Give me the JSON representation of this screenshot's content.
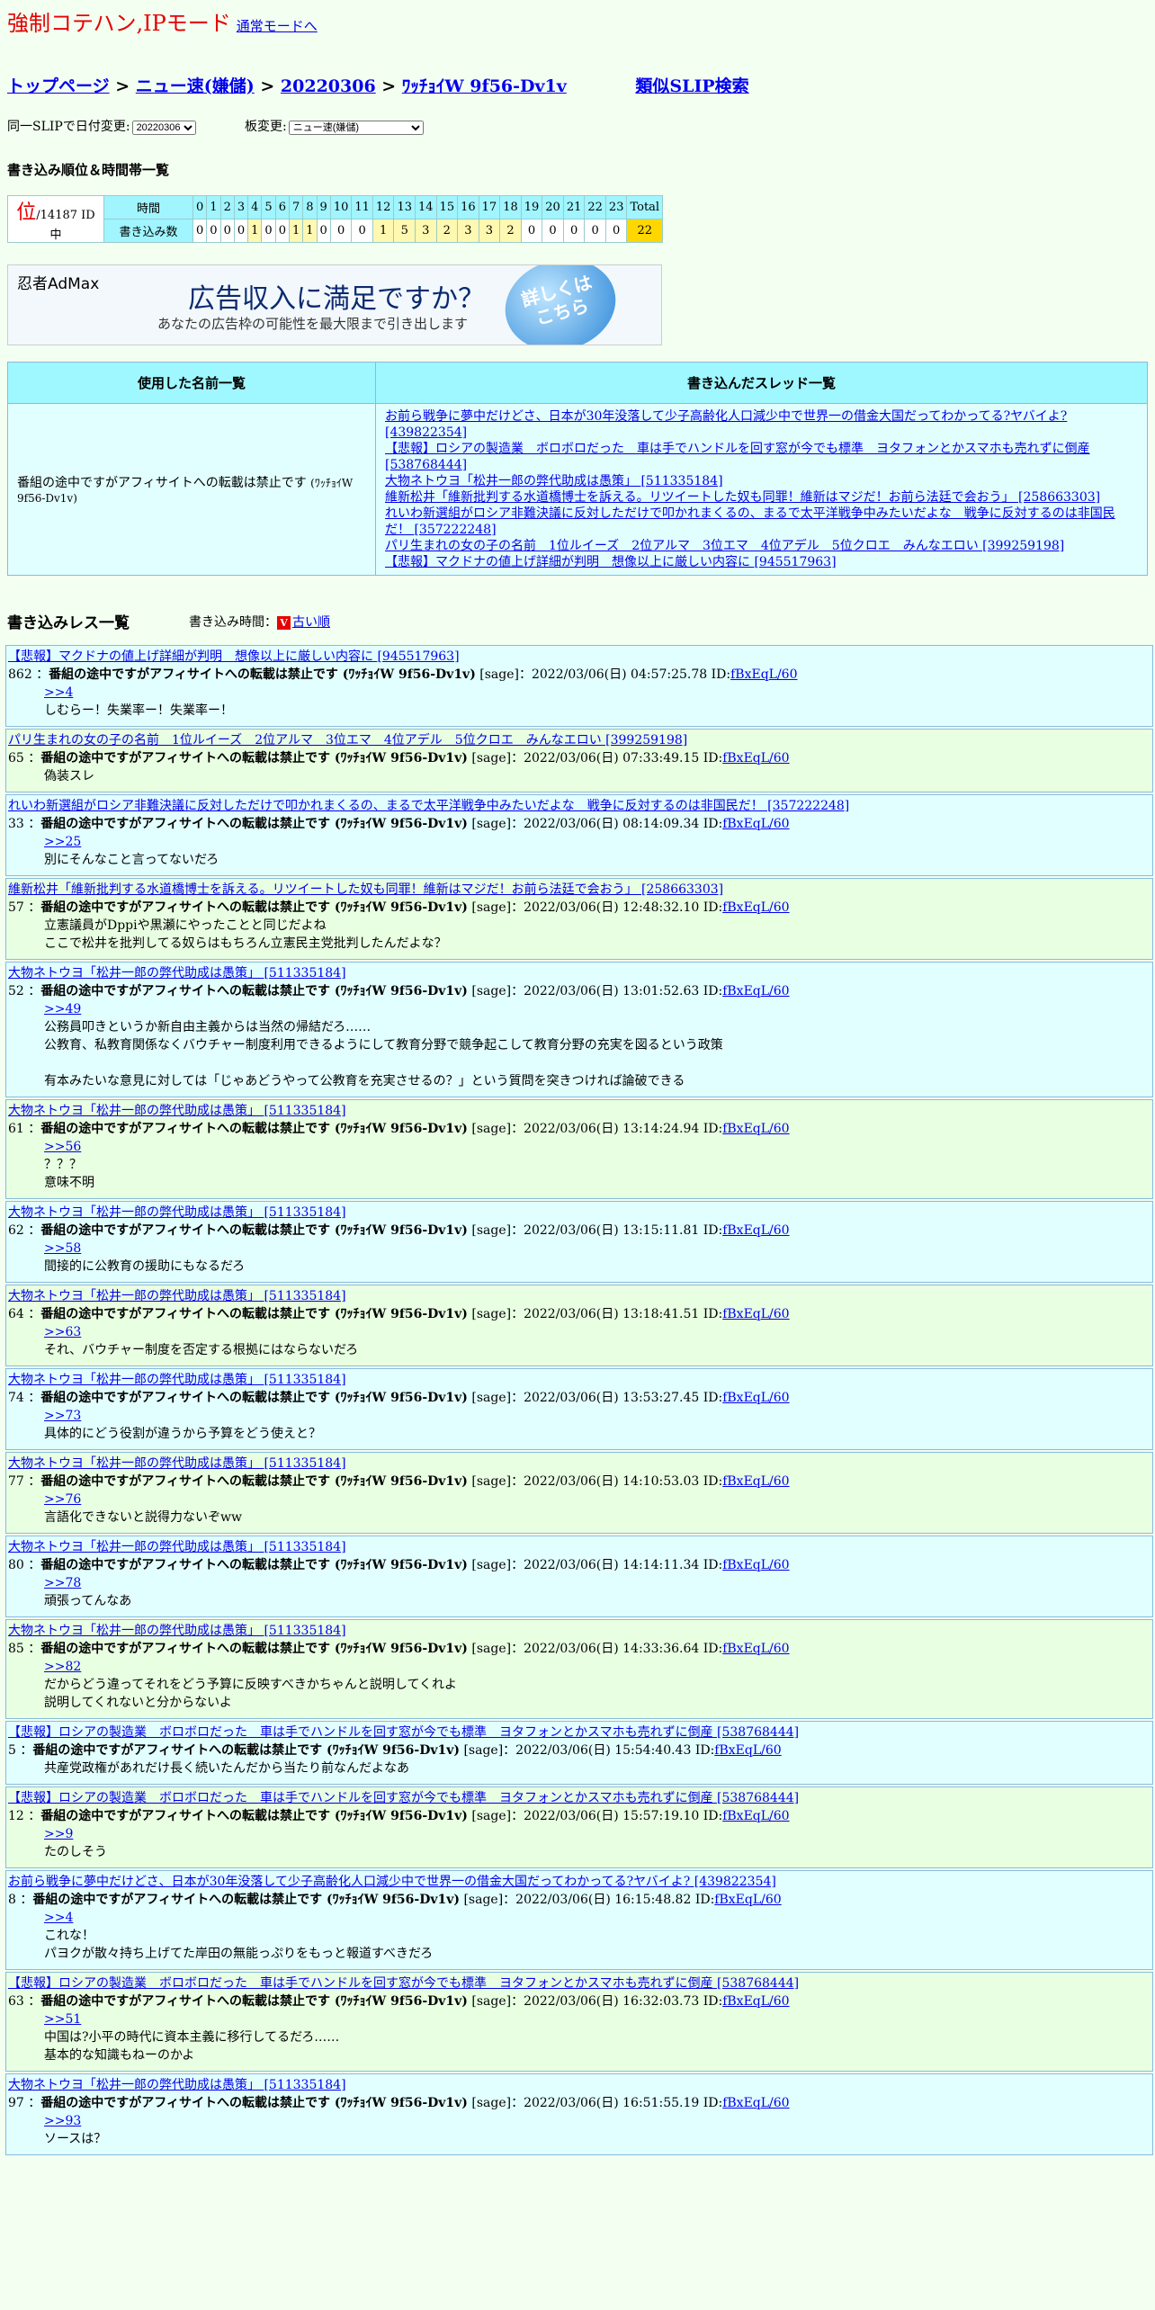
{
  "mode": {
    "title": "強制コテハン,IPモード",
    "link": "通常モードへ"
  },
  "breadcrumb": {
    "top": "トップページ",
    "board": "ニュー速(嫌儲)",
    "date": "20220306",
    "user": "ﾜｯﾁｮｲW 9f56-Dv1v",
    "similar": "類似SLIP検索"
  },
  "selectors": {
    "date_label": "同一SLIPで日付変更:",
    "date_value": "20220306",
    "board_label": "板変更:",
    "board_value": "ニュー速(嫌儲)"
  },
  "rank_section": {
    "title": "書き込み順位＆時間帯一覧",
    "rank_mark": "位",
    "rank_total": "/14187 ID中",
    "row_time": "時間",
    "row_posts": "書き込み数",
    "hours": [
      "0",
      "1",
      "2",
      "3",
      "4",
      "5",
      "6",
      "7",
      "8",
      "9",
      "10",
      "11",
      "12",
      "13",
      "14",
      "15",
      "16",
      "17",
      "18",
      "19",
      "20",
      "21",
      "22",
      "23",
      "Total"
    ],
    "counts": [
      "0",
      "0",
      "0",
      "0",
      "1",
      "0",
      "0",
      "1",
      "1",
      "0",
      "0",
      "0",
      "1",
      "5",
      "3",
      "2",
      "3",
      "3",
      "2",
      "0",
      "0",
      "0",
      "0",
      "0",
      "22"
    ]
  },
  "ad": {
    "logo": "忍者AdMax",
    "headline": "広告収入に満足ですか？",
    "sub": "あなたの広告枠の可能性を最大限まで引き出します",
    "cta": "詳しくは\nこちら"
  },
  "names_table": {
    "col_names": "使用した名前一覧",
    "col_threads": "書き込んだスレッド一覧",
    "name": "番組の途中ですがアフィサイトへの転載は禁止です",
    "name_small": "(ﾜｯﾁｮｲW 9f56-Dv1v)",
    "threads": [
      "お前ら戦争に夢中だけどさ、日本が30年没落して少子高齢化人口減少中で世界一の借金大国だってわかってる?ヤバイよ? [439822354]",
      "【悲報】ロシアの製造業　ボロボロだった　車は手でハンドルを回す窓が今でも標準　ヨタフォンとかスマホも売れずに倒産 [538768444]",
      "大物ネトウヨ「松井一郎の弊代助成は愚策」 [511335184]",
      "維新松井「維新批判する水道橋博士を訴える。リツイートした奴も同罪！維新はマジだ！お前ら法廷で会おう」 [258663303]",
      "れいわ新選組がロシア非難決議に反対しただけで叩かれまくるの、まるで太平洋戦争中みたいだよな　戦争に反対するのは非国民だ！ [357222248]",
      "パリ生まれの女の子の名前　1位ルイーズ　2位アルマ　3位エマ　4位アデル　5位クロエ　みんなエロい [399259198]",
      "【悲報】マクドナの値上げ詳細が判明　想像以上に厳しい内容に [945517963]"
    ]
  },
  "posts_header": {
    "title": "書き込みレス一覧",
    "time_label": "書き込み時間：",
    "order_icon": "V",
    "order_link": "古い順"
  },
  "poster": {
    "name": "番組の途中ですがアフィサイトへの転載は禁止です",
    "slip": "(ﾜｯﾁｮｲW 9f56-Dv1v)",
    "sage": "[sage]",
    "id_label": "ID:",
    "id": "fBxEqL/60"
  },
  "posts": [
    {
      "thread": "【悲報】マクドナの値上げ詳細が判明　想像以上に厳しい内容に [945517963]",
      "num": "862",
      "date": "2022/03/06(日) 04:57:25.78",
      "anchor": ">>4",
      "lines": [
        "しむらー！失業率ー！失業率ー！"
      ]
    },
    {
      "thread": "パリ生まれの女の子の名前　1位ルイーズ　2位アルマ　3位エマ　4位アデル　5位クロエ　みんなエロい [399259198]",
      "num": "65",
      "date": "2022/03/06(日) 07:33:49.15",
      "anchor": "",
      "lines": [
        "偽装スレ"
      ]
    },
    {
      "thread": "れいわ新選組がロシア非難決議に反対しただけで叩かれまくるの、まるで太平洋戦争中みたいだよな　戦争に反対するのは非国民だ！ [357222248]",
      "num": "33",
      "date": "2022/03/06(日) 08:14:09.34",
      "anchor": ">>25",
      "lines": [
        "別にそんなこと言ってないだろ"
      ]
    },
    {
      "thread": "維新松井「維新批判する水道橋博士を訴える。リツイートした奴も同罪！維新はマジだ！お前ら法廷で会おう」 [258663303]",
      "num": "57",
      "date": "2022/03/06(日) 12:48:32.10",
      "anchor": "",
      "lines": [
        "立憲議員がDppiや黒瀬にやったことと同じだよね",
        "ここで松井を批判してる奴らはもちろん立憲民主党批判したんだよな？"
      ]
    },
    {
      "thread": "大物ネトウヨ「松井一郎の弊代助成は愚策」 [511335184]",
      "num": "52",
      "date": "2022/03/06(日) 13:01:52.63",
      "anchor": ">>49",
      "lines": [
        "公務員叩きというか新自由主義からは当然の帰結だろ……",
        "公教育、私教育関係なくバウチャー制度利用できるようにして教育分野で競争起こして教育分野の充実を図るという政策",
        "",
        "有本みたいな意見に対しては「じゃあどうやって公教育を充実させるの？」という質問を突きつければ論破できる"
      ]
    },
    {
      "thread": "大物ネトウヨ「松井一郎の弊代助成は愚策」 [511335184]",
      "num": "61",
      "date": "2022/03/06(日) 13:14:24.94",
      "anchor": ">>56",
      "lines": [
        "？？？",
        "意味不明"
      ]
    },
    {
      "thread": "大物ネトウヨ「松井一郎の弊代助成は愚策」 [511335184]",
      "num": "62",
      "date": "2022/03/06(日) 13:15:11.81",
      "anchor": ">>58",
      "lines": [
        "間接的に公教育の援助にもなるだろ"
      ]
    },
    {
      "thread": "大物ネトウヨ「松井一郎の弊代助成は愚策」 [511335184]",
      "num": "64",
      "date": "2022/03/06(日) 13:18:41.51",
      "anchor": ">>63",
      "lines": [
        "それ、バウチャー制度を否定する根拠にはならないだろ"
      ]
    },
    {
      "thread": "大物ネトウヨ「松井一郎の弊代助成は愚策」 [511335184]",
      "num": "74",
      "date": "2022/03/06(日) 13:53:27.45",
      "anchor": ">>73",
      "lines": [
        "具体的にどう役割が違うから予算をどう使えと？"
      ]
    },
    {
      "thread": "大物ネトウヨ「松井一郎の弊代助成は愚策」 [511335184]",
      "num": "77",
      "date": "2022/03/06(日) 14:10:53.03",
      "anchor": ">>76",
      "lines": [
        "言語化できないと説得力ないぞww"
      ]
    },
    {
      "thread": "大物ネトウヨ「松井一郎の弊代助成は愚策」 [511335184]",
      "num": "80",
      "date": "2022/03/06(日) 14:14:11.34",
      "anchor": ">>78",
      "lines": [
        "頑張ってんなあ"
      ]
    },
    {
      "thread": "大物ネトウヨ「松井一郎の弊代助成は愚策」 [511335184]",
      "num": "85",
      "date": "2022/03/06(日) 14:33:36.64",
      "anchor": ">>82",
      "lines": [
        "だからどう違ってそれをどう予算に反映すべきかちゃんと説明してくれよ",
        "説明してくれないと分からないよ"
      ]
    },
    {
      "thread": "【悲報】ロシアの製造業　ボロボロだった　車は手でハンドルを回す窓が今でも標準　ヨタフォンとかスマホも売れずに倒産 [538768444]",
      "num": "5",
      "date": "2022/03/06(日) 15:54:40.43",
      "anchor": "",
      "lines": [
        "共産党政権があれだけ長く続いたんだから当たり前なんだよなあ"
      ]
    },
    {
      "thread": "【悲報】ロシアの製造業　ボロボロだった　車は手でハンドルを回す窓が今でも標準　ヨタフォンとかスマホも売れずに倒産 [538768444]",
      "num": "12",
      "date": "2022/03/06(日) 15:57:19.10",
      "anchor": ">>9",
      "lines": [
        "たのしそう"
      ]
    },
    {
      "thread": "お前ら戦争に夢中だけどさ、日本が30年没落して少子高齢化人口減少中で世界一の借金大国だってわかってる?ヤバイよ? [439822354]",
      "num": "8",
      "date": "2022/03/06(日) 16:15:48.82",
      "anchor": ">>4",
      "lines": [
        "これな！",
        "パヨクが散々持ち上げてた岸田の無能っぷりをもっと報道すべきだろ"
      ]
    },
    {
      "thread": "【悲報】ロシアの製造業　ボロボロだった　車は手でハンドルを回す窓が今でも標準　ヨタフォンとかスマホも売れずに倒産 [538768444]",
      "num": "63",
      "date": "2022/03/06(日) 16:32:03.73",
      "anchor": ">>51",
      "lines": [
        "中国は?小平の時代に資本主義に移行してるだろ……",
        "基本的な知識もねーのかよ"
      ]
    },
    {
      "thread": "大物ネトウヨ「松井一郎の弊代助成は愚策」 [511335184]",
      "num": "97",
      "date": "2022/03/06(日) 16:51:55.19",
      "anchor": ">>93",
      "lines": [
        "ソースは？"
      ]
    }
  ]
}
